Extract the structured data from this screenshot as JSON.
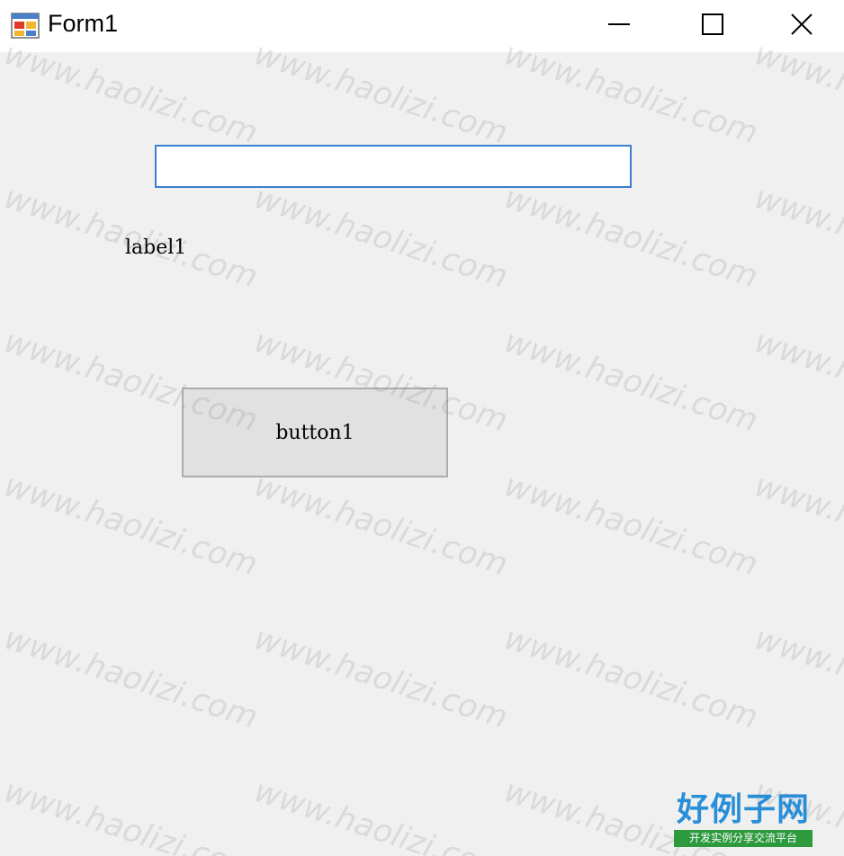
{
  "window": {
    "title": "Form1",
    "app_icon": "windows-forms-icon",
    "controls": {
      "minimize": "minimize-icon",
      "maximize": "maximize-icon",
      "close": "close-icon"
    }
  },
  "form": {
    "textbox": {
      "value": ""
    },
    "label1": "label1",
    "button1": "button1"
  },
  "watermark": {
    "text": "www.haolizi.com",
    "color": "#787878"
  },
  "logo": {
    "main": "好例子网",
    "sub": "开发实例分享交流平台",
    "main_color": "#2a8fd9",
    "sub_bg_color": "#2d9a3e"
  },
  "colors": {
    "client_bg": "#f0f0f0",
    "textbox_border": "#3b7fd1",
    "button_bg": "#e1e1e1",
    "button_border": "#adadad"
  }
}
